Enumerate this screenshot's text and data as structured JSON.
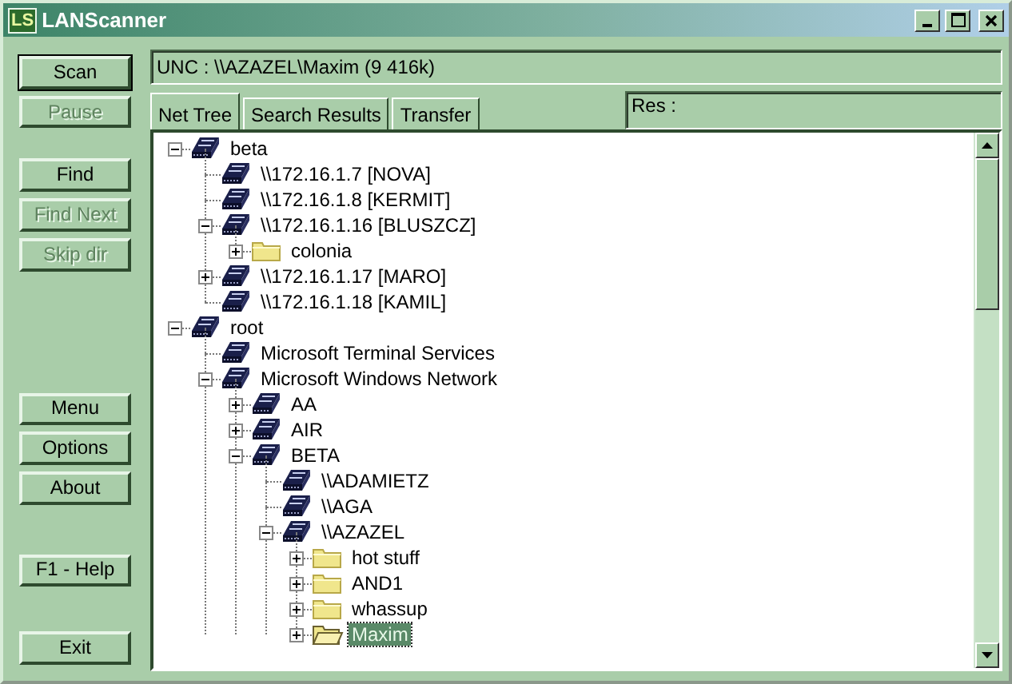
{
  "window": {
    "logo": "LS",
    "title": "LANScanner"
  },
  "buttons": [
    {
      "label": "Scan",
      "disabled": false,
      "focused": true
    },
    {
      "label": "Pause",
      "disabled": true,
      "focused": false
    },
    {
      "label": "Find",
      "disabled": false,
      "focused": false
    },
    {
      "label": "Find Next",
      "disabled": true,
      "focused": false
    },
    {
      "label": "Skip dir",
      "disabled": true,
      "focused": false
    },
    {
      "label": "Menu",
      "disabled": false,
      "focused": false
    },
    {
      "label": "Options",
      "disabled": false,
      "focused": false
    },
    {
      "label": "About",
      "disabled": false,
      "focused": false
    },
    {
      "label": "F1 - Help",
      "disabled": false,
      "focused": false
    },
    {
      "label": "Exit",
      "disabled": false,
      "focused": false
    }
  ],
  "unc": "UNC : \\\\AZAZEL\\Maxim  (9 416k)",
  "tabs": [
    {
      "label": "Net Tree",
      "selected": true
    },
    {
      "label": "Search Results",
      "selected": false
    },
    {
      "label": "Transfer",
      "selected": false
    }
  ],
  "res": "Res :",
  "tree": [
    {
      "label": "beta",
      "kind": "computer",
      "expanded": true,
      "selected": false,
      "children": [
        {
          "label": "\\\\172.16.1.7 [NOVA]",
          "kind": "computer",
          "selected": false
        },
        {
          "label": "\\\\172.16.1.8 [KERMIT]",
          "kind": "computer",
          "selected": false
        },
        {
          "label": "\\\\172.16.1.16 [BLUSZCZ]",
          "kind": "computer",
          "expanded": true,
          "selected": false,
          "children": [
            {
              "label": "colonia",
              "kind": "folder",
              "expanded": false,
              "selected": false
            }
          ]
        },
        {
          "label": "\\\\172.16.1.17 [MARO]",
          "kind": "computer",
          "expanded": false,
          "selected": false
        },
        {
          "label": "\\\\172.16.1.18 [KAMIL]",
          "kind": "computer",
          "selected": false
        }
      ]
    },
    {
      "label": "root",
      "kind": "computer",
      "expanded": true,
      "selected": false,
      "children": [
        {
          "label": "Microsoft Terminal Services",
          "kind": "computer",
          "selected": false
        },
        {
          "label": "Microsoft Windows Network",
          "kind": "computer",
          "expanded": true,
          "selected": false,
          "children": [
            {
              "label": "AA",
              "kind": "computer",
              "expanded": false,
              "selected": false
            },
            {
              "label": "AIR",
              "kind": "computer",
              "expanded": false,
              "selected": false
            },
            {
              "label": "BETA",
              "kind": "computer",
              "expanded": true,
              "selected": false,
              "children": [
                {
                  "label": "\\\\ADAMIETZ",
                  "kind": "computer",
                  "selected": false
                },
                {
                  "label": "\\\\AGA",
                  "kind": "computer",
                  "selected": false
                },
                {
                  "label": "\\\\AZAZEL",
                  "kind": "computer",
                  "expanded": true,
                  "selected": false,
                  "children": [
                    {
                      "label": "hot stuff",
                      "kind": "folder",
                      "expanded": false,
                      "selected": false
                    },
                    {
                      "label": "AND1",
                      "kind": "folder",
                      "expanded": false,
                      "selected": false
                    },
                    {
                      "label": "whassup",
                      "kind": "folder",
                      "expanded": false,
                      "selected": false
                    },
                    {
                      "label": "Maxim",
                      "kind": "folder",
                      "expanded": false,
                      "selected": true
                    }
                  ]
                }
              ]
            }
          ]
        }
      ]
    }
  ]
}
